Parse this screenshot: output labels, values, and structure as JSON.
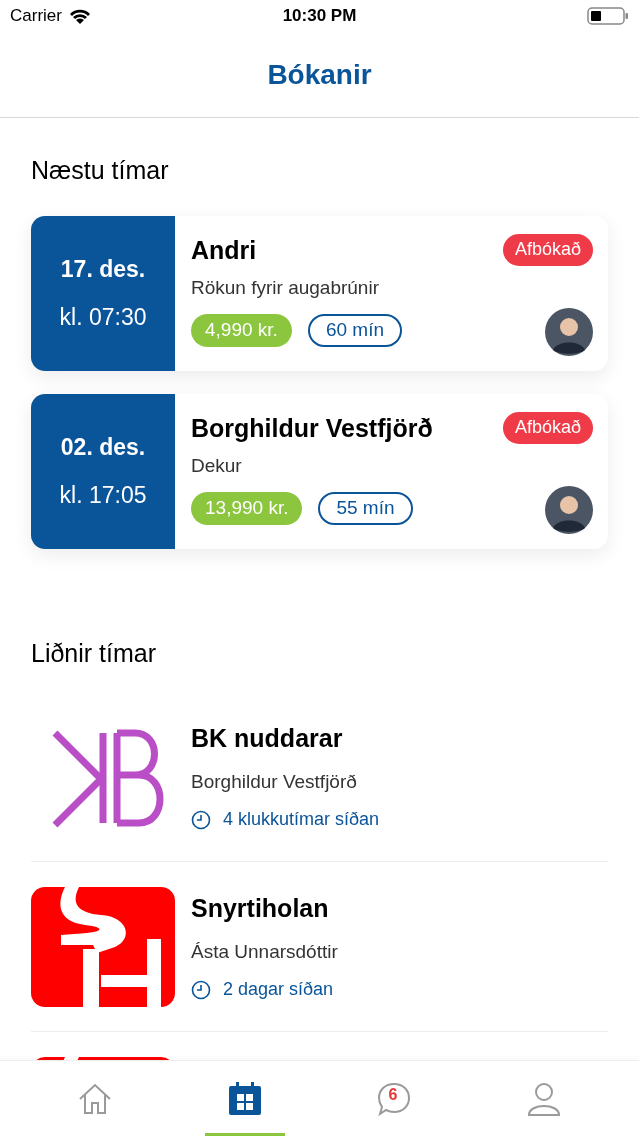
{
  "status_bar": {
    "carrier": "Carrier",
    "time": "10:30 PM"
  },
  "header": {
    "title": "Bókanir"
  },
  "upcoming": {
    "heading": "Næstu tímar",
    "bookings": [
      {
        "date": "17. des.",
        "time": "kl. 07:30",
        "name": "Andri",
        "service": "Rökun fyrir augabrúnir",
        "price": "4,990 kr.",
        "duration": "60 mín",
        "status": "Afbókað"
      },
      {
        "date": "02. des.",
        "time": "kl. 17:05",
        "name": "Borghildur Vestfjörð",
        "service": "Dekur",
        "price": "13,990 kr.",
        "duration": "55 mín",
        "status": "Afbókað"
      }
    ]
  },
  "past": {
    "heading": "Liðnir tímar",
    "items": [
      {
        "kind": "kb",
        "name": "BK nuddarar",
        "person": "Borghildur Vestfjörð",
        "ago": "4 klukkutímar síðan"
      },
      {
        "kind": "sh",
        "name": "Snyrtiholan",
        "person": "Ásta Unnarsdóttir",
        "ago": "2 dagar síðan"
      }
    ]
  },
  "tab_bar": [
    {
      "kind": "home",
      "selected": false
    },
    {
      "kind": "calendar",
      "selected": true
    },
    {
      "kind": "messages",
      "selected": false,
      "badge": "6"
    },
    {
      "kind": "profile",
      "selected": false
    }
  ]
}
